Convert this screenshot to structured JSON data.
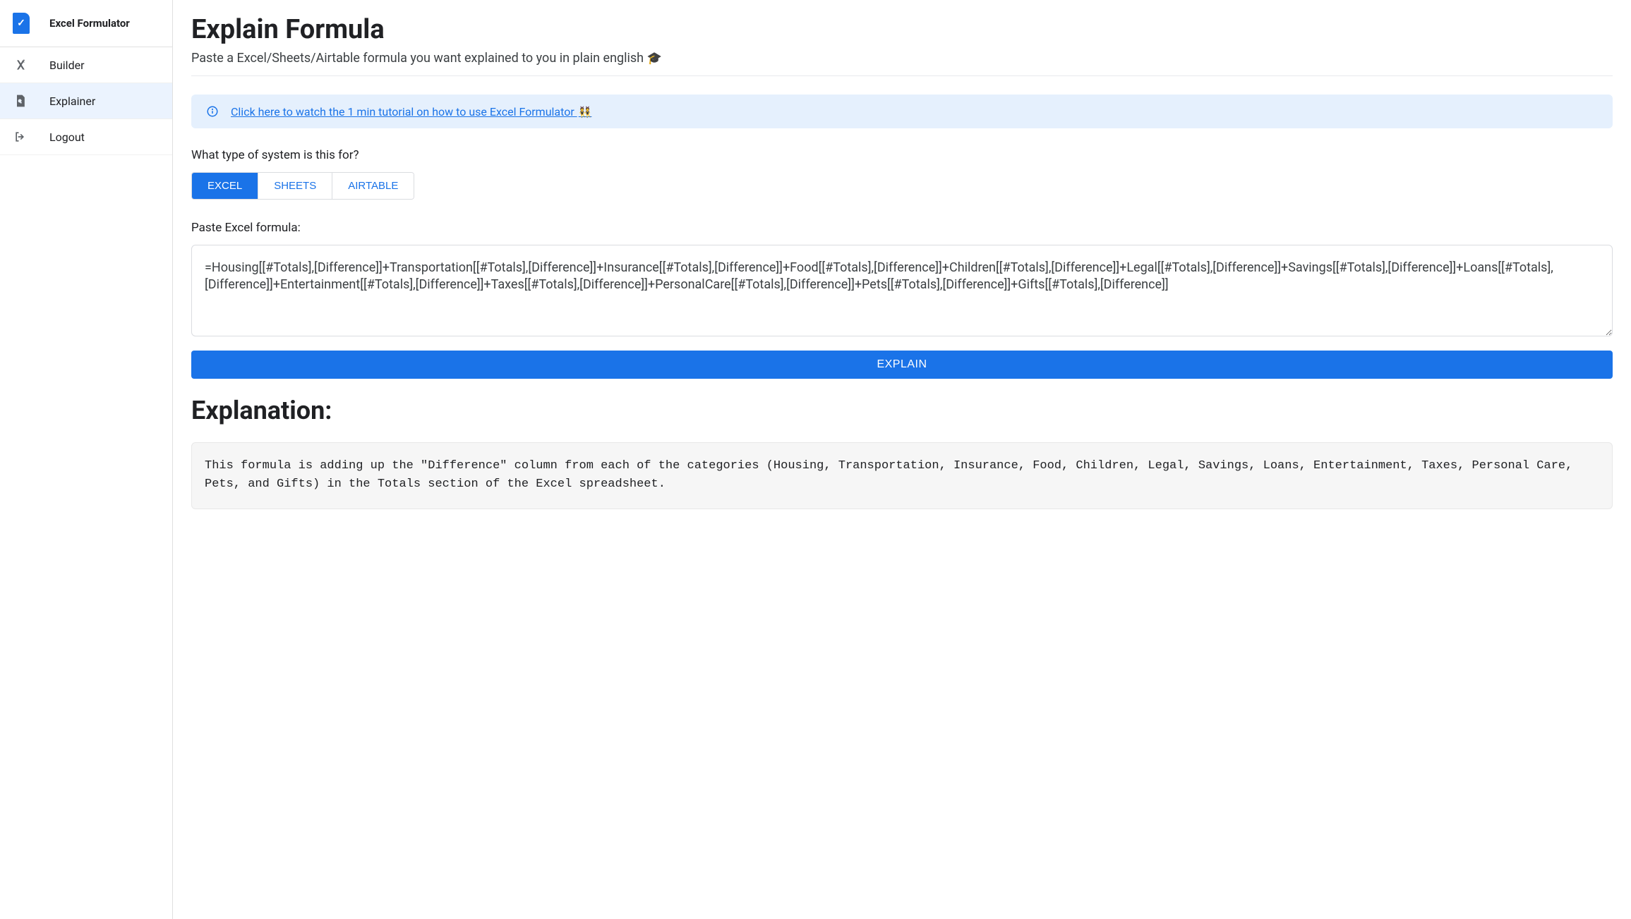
{
  "sidebar": {
    "app_name": "Excel Formulator",
    "items": [
      {
        "label": "Builder",
        "icon": "formula-icon",
        "active": false
      },
      {
        "label": "Explainer",
        "icon": "search-doc-icon",
        "active": true
      },
      {
        "label": "Logout",
        "icon": "logout-icon",
        "active": false
      }
    ]
  },
  "page": {
    "title": "Explain Formula",
    "subtitle": "Paste a Excel/Sheets/Airtable formula you want explained to you in plain english ",
    "cap_emoji": "🎓"
  },
  "banner": {
    "link_text": "Click here to watch the 1 min tutorial on how to use Excel Formulator ",
    "emoji": "👯"
  },
  "system_type": {
    "label": "What type of system is this for?",
    "options": [
      "EXCEL",
      "SHEETS",
      "AIRTABLE"
    ],
    "selected": "EXCEL"
  },
  "formula_input": {
    "label": "Paste Excel formula:",
    "value": "=Housing[[#Totals],[Difference]]+Transportation[[#Totals],[Difference]]+Insurance[[#Totals],[Difference]]+Food[[#Totals],[Difference]]+Children[[#Totals],[Difference]]+Legal[[#Totals],[Difference]]+Savings[[#Totals],[Difference]]+Loans[[#Totals],[Difference]]+Entertainment[[#Totals],[Difference]]+Taxes[[#Totals],[Difference]]+PersonalCare[[#Totals],[Difference]]+Pets[[#Totals],[Difference]]+Gifts[[#Totals],[Difference]]"
  },
  "explain_button": "EXPLAIN",
  "explanation": {
    "heading": "Explanation:",
    "body": "This formula is adding up the \"Difference\" column from each of the categories (Housing, Transportation, Insurance, Food, Children, Legal, Savings, Loans, Entertainment, Taxes, Personal Care, Pets, and Gifts) in the Totals section of the Excel spreadsheet."
  }
}
